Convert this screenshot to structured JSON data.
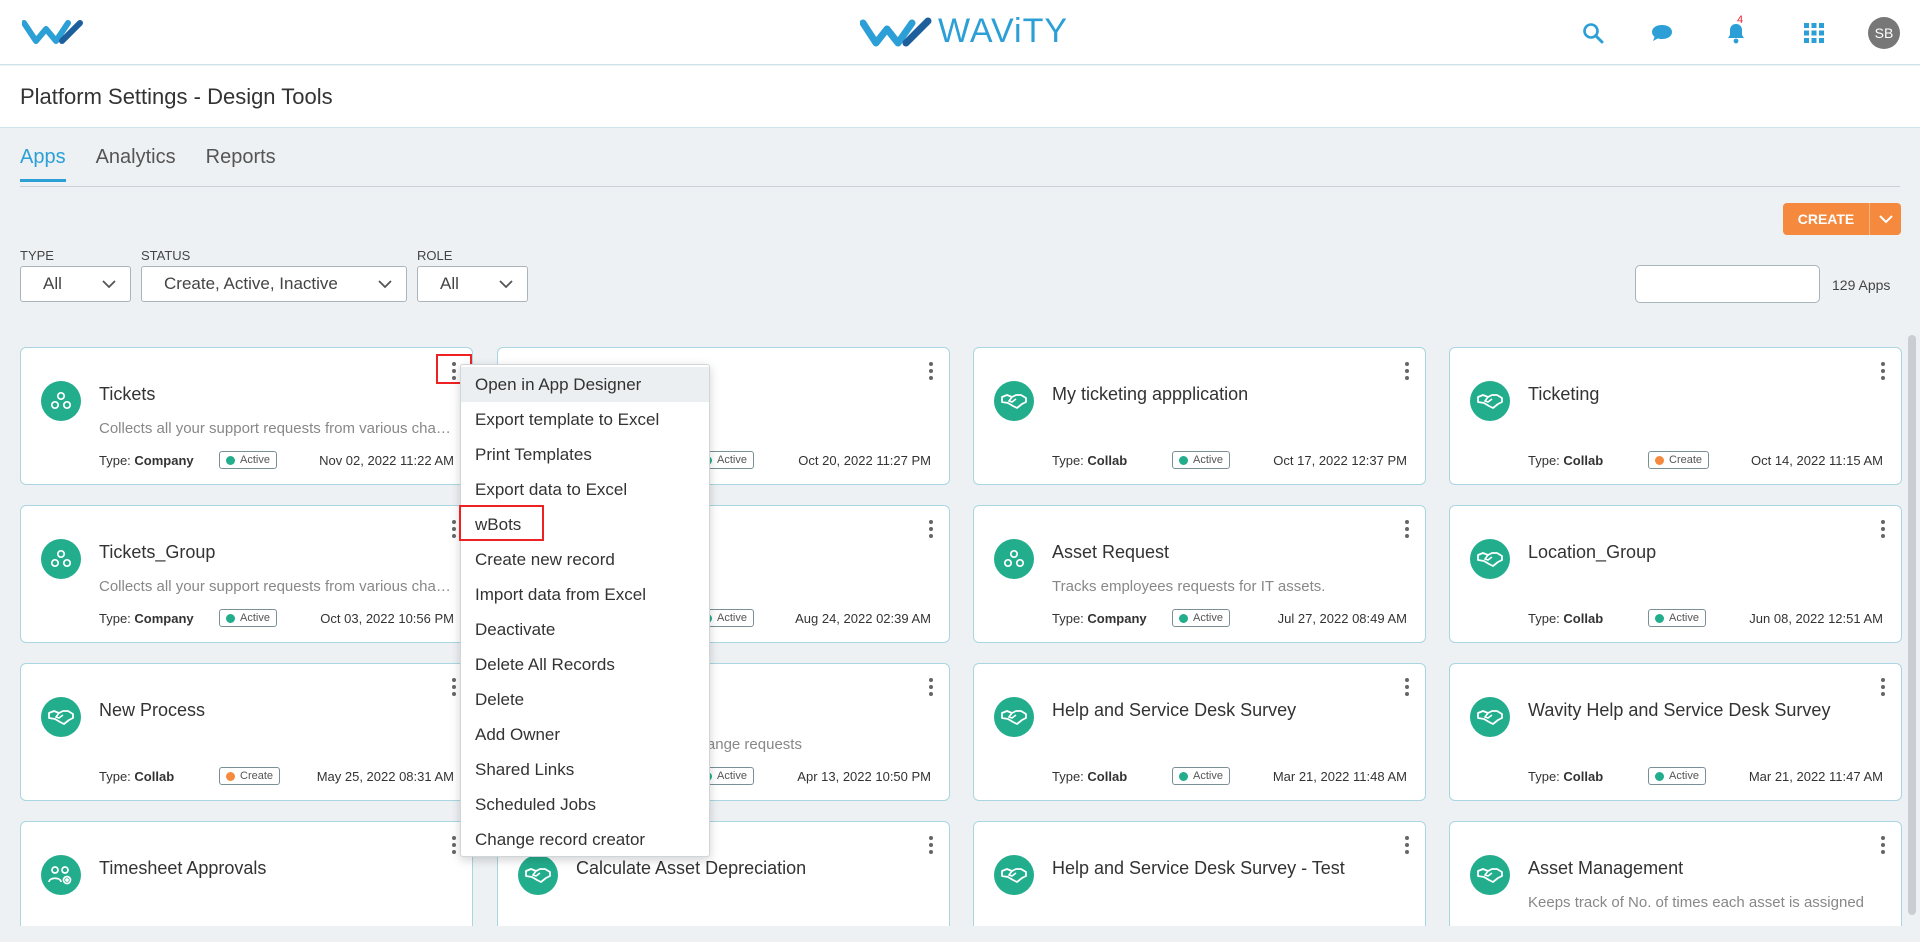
{
  "header": {
    "brand_name": "WAViTY",
    "notification_count": "4",
    "avatar_initials": "SB"
  },
  "page": {
    "title": "Platform Settings - Design Tools"
  },
  "tabs": [
    {
      "label": "Apps",
      "active": true
    },
    {
      "label": "Analytics",
      "active": false
    },
    {
      "label": "Reports",
      "active": false
    }
  ],
  "create_button": {
    "label": "CREATE"
  },
  "filters": {
    "type": {
      "label": "TYPE",
      "value": "All"
    },
    "status": {
      "label": "STATUS",
      "value": "Create, Active, Inactive"
    },
    "role": {
      "label": "ROLE",
      "value": "All"
    }
  },
  "search": {
    "placeholder": "",
    "count": "129 Apps"
  },
  "type_prefix": "Type:",
  "cards": [
    {
      "title": "Tickets",
      "desc": "Collects all your support requests from various channels",
      "type": "Company",
      "status": "Active",
      "date": "Nov 02, 2022 11:22 AM",
      "icon": "people-group-icon"
    },
    {
      "title": "",
      "desc": "",
      "type": "",
      "status": "Active",
      "date": "Oct 20, 2022 11:27 PM",
      "icon": "handshake-icon"
    },
    {
      "title": "My ticketing appplication",
      "desc": "",
      "type": "Collab",
      "status": "Active",
      "date": "Oct 17, 2022 12:37 PM",
      "icon": "handshake-icon"
    },
    {
      "title": "Ticketing",
      "desc": "",
      "type": "Collab",
      "status": "Create",
      "date": "Oct 14, 2022 11:15 AM",
      "icon": "handshake-icon"
    },
    {
      "title": "Tickets_Group",
      "desc": "Collects all your support requests from various channels",
      "type": "Company",
      "status": "Active",
      "date": "Oct 03, 2022 10:56 PM",
      "icon": "people-group-icon"
    },
    {
      "title": "",
      "desc": "",
      "type": "",
      "status": "Active",
      "date": "Aug 24, 2022 02:39 AM",
      "icon": "handshake-icon"
    },
    {
      "title": "Asset Request",
      "desc": "Tracks employees requests for IT assets.",
      "type": "Company",
      "status": "Active",
      "date": "Jul 27, 2022 08:49 AM",
      "icon": "people-group-icon"
    },
    {
      "title": "Location_Group",
      "desc": "",
      "type": "Collab",
      "status": "Active",
      "date": "Jun 08, 2022 12:51 AM",
      "icon": "handshake-icon"
    },
    {
      "title": "New Process",
      "desc": "",
      "type": "Collab",
      "status": "Create",
      "date": "May 25, 2022 08:31 AM",
      "icon": "handshake-icon"
    },
    {
      "title": "",
      "desc": "AB approvals for change requests",
      "type": "",
      "status": "Active",
      "date": "Apr 13, 2022 10:50 PM",
      "icon": "handshake-icon"
    },
    {
      "title": "Help and Service Desk Survey",
      "desc": "",
      "type": "Collab",
      "status": "Active",
      "date": "Mar 21, 2022 11:48 AM",
      "icon": "handshake-icon"
    },
    {
      "title": "Wavity Help and Service Desk Survey",
      "desc": "",
      "type": "Collab",
      "status": "Active",
      "date": "Mar 21, 2022 11:47 AM",
      "icon": "handshake-icon"
    },
    {
      "title": "Timesheet Approvals",
      "desc": "",
      "type": "",
      "status": "",
      "date": "",
      "icon": "people-gear-icon"
    },
    {
      "title": "Calculate Asset Depreciation",
      "desc": "",
      "type": "",
      "status": "",
      "date": "",
      "icon": "handshake-icon"
    },
    {
      "title": "Help and Service Desk Survey - Test",
      "desc": "",
      "type": "",
      "status": "",
      "date": "",
      "icon": "handshake-icon"
    },
    {
      "title": "Asset Management",
      "desc": "Keeps track of No. of times each asset is assigned",
      "type": "",
      "status": "",
      "date": "",
      "icon": "handshake-icon"
    }
  ],
  "context_menu": {
    "items": [
      "Open in App Designer",
      "Export template to Excel",
      "Print Templates",
      "Export data to Excel",
      "wBots",
      "Create new record",
      "Import data from Excel",
      "Deactivate",
      "Delete All Records",
      "Delete",
      "Add Owner",
      "Shared Links",
      "Scheduled Jobs",
      "Change record creator"
    ]
  },
  "colors": {
    "brand_blue": "#2b9fd6",
    "accent_orange": "#f5893e",
    "app_icon_green": "#22ad8c",
    "highlight_red": "#ee2222"
  }
}
